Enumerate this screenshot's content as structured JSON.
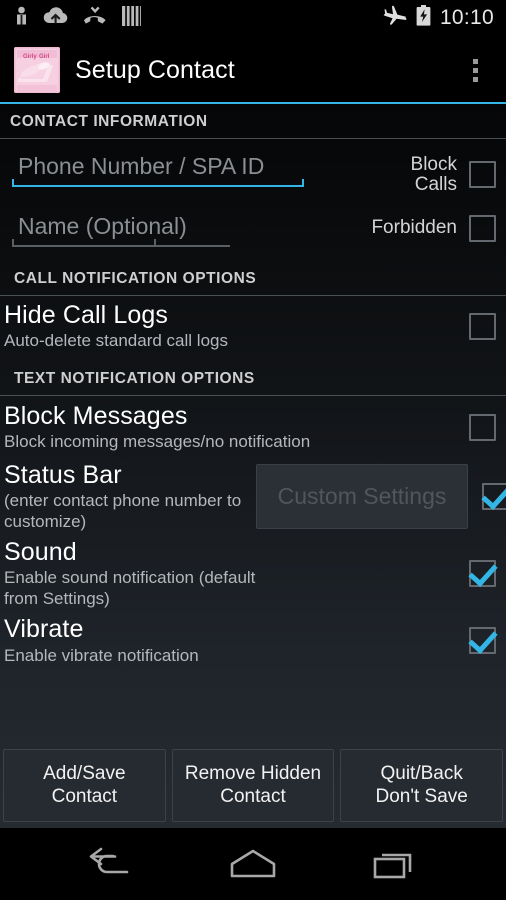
{
  "status_bar": {
    "icons_left": [
      "person-icon",
      "cloud-upload-icon",
      "missed-call-icon",
      "sim-bars-icon"
    ],
    "icons_right": [
      "airplane-mode-icon",
      "battery-charging-icon"
    ],
    "time": "10:10"
  },
  "action_bar": {
    "app_icon": "girly-girl-app-icon",
    "title": "Setup Contact",
    "overflow": "overflow-menu-icon"
  },
  "sections": {
    "contact_information": "CONTACT INFORMATION",
    "call_notification_options": "CALL NOTIFICATION OPTIONS",
    "text_notification_options": "TEXT NOTIFICATION OPTIONS"
  },
  "fields": {
    "phone": {
      "value": "",
      "placeholder": "Phone Number / SPA ID",
      "focused": true
    },
    "name": {
      "value": "",
      "placeholder": "Name (Optional)",
      "focused": false
    }
  },
  "side_toggles": {
    "block_calls": {
      "label": "Block\nCalls",
      "label_line1": "Block",
      "label_line2": "Calls",
      "checked": false
    },
    "forbidden": {
      "label": "Forbidden",
      "checked": false
    }
  },
  "settings": [
    {
      "title": "Hide Call Logs",
      "subtitle": "Auto-delete standard call logs",
      "checked": false
    },
    {
      "title": "Block Messages",
      "subtitle": "Block incoming messages/no notification",
      "checked": false
    },
    {
      "title": "Status Bar",
      "subtitle": "(enter contact phone number to customize)",
      "button": "Custom Settings",
      "button_enabled": false,
      "checked": true
    },
    {
      "title": "Sound",
      "subtitle": "Enable sound notification (default from Settings)",
      "checked": true
    },
    {
      "title": "Vibrate",
      "subtitle": "Enable vibrate notification",
      "checked": true
    }
  ],
  "buttons": [
    {
      "line1": "Add/Save",
      "line2": "Contact"
    },
    {
      "line1": "Remove Hidden",
      "line2": "Contact"
    },
    {
      "line1": "Quit/Back",
      "line2": "Don't Save"
    }
  ],
  "nav_bar": {
    "back": "back-icon",
    "home": "home-icon",
    "recents": "recents-icon"
  },
  "colors": {
    "accent": "#33b5e5",
    "background": "#101315",
    "text_primary": "#ffffff",
    "text_secondary": "#b4b8bc",
    "divider": "#4a4f54",
    "button_face": "#262b31",
    "disabled_text": "#4f565d"
  }
}
